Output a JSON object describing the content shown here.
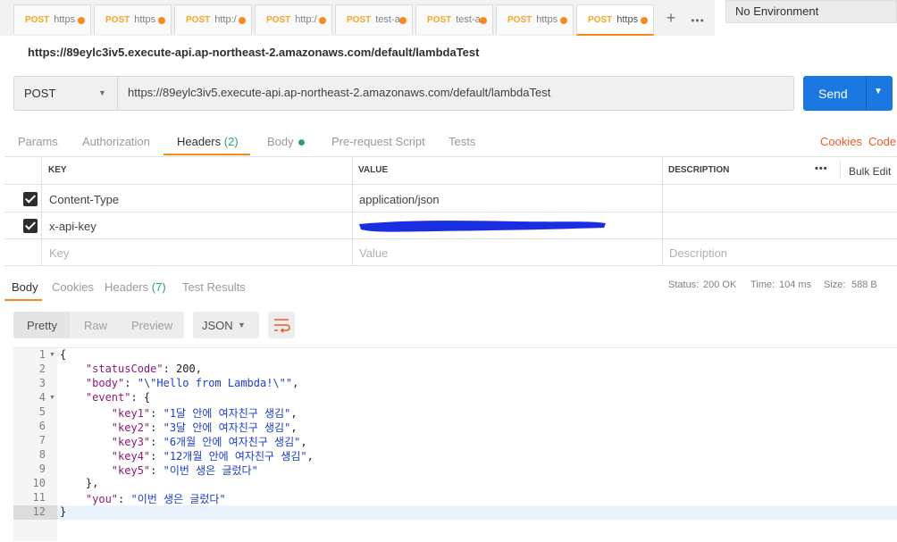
{
  "tabs": [
    {
      "method": "POST",
      "url": "https"
    },
    {
      "method": "POST",
      "url": "https"
    },
    {
      "method": "POST",
      "url": "http:/"
    },
    {
      "method": "POST",
      "url": "http:/"
    },
    {
      "method": "POST",
      "url": "test-a"
    },
    {
      "method": "POST",
      "url": "test-a"
    },
    {
      "method": "POST",
      "url": "https"
    },
    {
      "method": "POST",
      "url": "https"
    }
  ],
  "tab_actions": {
    "new_tab": "+",
    "more": "•••"
  },
  "environment": {
    "selected": "No Environment"
  },
  "request": {
    "title": "https://89eylc3iv5.execute-api.ap-northeast-2.amazonaws.com/default/lambdaTest",
    "method": "POST",
    "url": "https://89eylc3iv5.execute-api.ap-northeast-2.amazonaws.com/default/lambdaTest",
    "send_label": "Send"
  },
  "request_tabs": {
    "params": "Params",
    "authorization": "Authorization",
    "headers": "Headers",
    "headers_count": "(2)",
    "body": "Body",
    "prerequest": "Pre-request Script",
    "tests": "Tests",
    "cookies": "Cookies",
    "code": "Code"
  },
  "headers_table": {
    "col_key": "KEY",
    "col_value": "VALUE",
    "col_description": "DESCRIPTION",
    "more": "•••",
    "bulk_edit": "Bulk Edit",
    "rows": [
      {
        "key": "Content-Type",
        "value": "application/json",
        "checked": true
      },
      {
        "key": "x-api-key",
        "value": "",
        "checked": true
      }
    ],
    "new_row": {
      "key": "Key",
      "value": "Value",
      "description": "Description"
    }
  },
  "response": {
    "tabs": {
      "body": "Body",
      "cookies": "Cookies",
      "headers": "Headers",
      "headers_count": "(7)",
      "test_results": "Test Results"
    },
    "status_label": "Status:",
    "status_value": "200 OK",
    "time_label": "Time:",
    "time_value": "104 ms",
    "size_label": "Size:",
    "size_value": "588 B",
    "view_modes": {
      "pretty": "Pretty",
      "raw": "Raw",
      "preview": "Preview"
    },
    "format": "JSON"
  },
  "code_lines": [
    {
      "n": "1",
      "parts": [
        [
          "n",
          "{"
        ]
      ]
    },
    {
      "n": "2",
      "parts": [
        [
          "n",
          "    "
        ],
        [
          "k",
          "\"statusCode\""
        ],
        [
          "n",
          ": 200,"
        ]
      ]
    },
    {
      "n": "3",
      "parts": [
        [
          "n",
          "    "
        ],
        [
          "k",
          "\"body\""
        ],
        [
          "n",
          ": "
        ],
        [
          "s",
          "\"\\\"Hello from Lambda!\\\"\""
        ],
        [
          "n",
          ","
        ]
      ]
    },
    {
      "n": "4",
      "parts": [
        [
          "n",
          "    "
        ],
        [
          "k",
          "\"event\""
        ],
        [
          "n",
          ": {"
        ]
      ]
    },
    {
      "n": "5",
      "parts": [
        [
          "n",
          "        "
        ],
        [
          "k",
          "\"key1\""
        ],
        [
          "n",
          ": "
        ],
        [
          "s",
          "\"1달 안에 여자친구 생김\""
        ],
        [
          "n",
          ","
        ]
      ]
    },
    {
      "n": "6",
      "parts": [
        [
          "n",
          "        "
        ],
        [
          "k",
          "\"key2\""
        ],
        [
          "n",
          ": "
        ],
        [
          "s",
          "\"3달 안에 여자친구 생김\""
        ],
        [
          "n",
          ","
        ]
      ]
    },
    {
      "n": "7",
      "parts": [
        [
          "n",
          "        "
        ],
        [
          "k",
          "\"key3\""
        ],
        [
          "n",
          ": "
        ],
        [
          "s",
          "\"6개월 안에 여자친구 생김\""
        ],
        [
          "n",
          ","
        ]
      ]
    },
    {
      "n": "8",
      "parts": [
        [
          "n",
          "        "
        ],
        [
          "k",
          "\"key4\""
        ],
        [
          "n",
          ": "
        ],
        [
          "s",
          "\"12개월 안에 여자친구 생김\""
        ],
        [
          "n",
          ","
        ]
      ]
    },
    {
      "n": "9",
      "parts": [
        [
          "n",
          "        "
        ],
        [
          "k",
          "\"key5\""
        ],
        [
          "n",
          ": "
        ],
        [
          "s",
          "\"이번 생은 글렀다\""
        ]
      ]
    },
    {
      "n": "10",
      "parts": [
        [
          "n",
          "    },"
        ]
      ]
    },
    {
      "n": "11",
      "parts": [
        [
          "n",
          "    "
        ],
        [
          "k",
          "\"you\""
        ],
        [
          "n",
          ": "
        ],
        [
          "s",
          "\"이번 생은 글렀다\""
        ]
      ]
    },
    {
      "n": "12",
      "parts": [
        [
          "n",
          "}"
        ]
      ]
    }
  ],
  "colors": {
    "accent": "#f68a1f",
    "send": "#1b78e0",
    "status_ok": "#2aa36b",
    "link": "#f05a28"
  }
}
